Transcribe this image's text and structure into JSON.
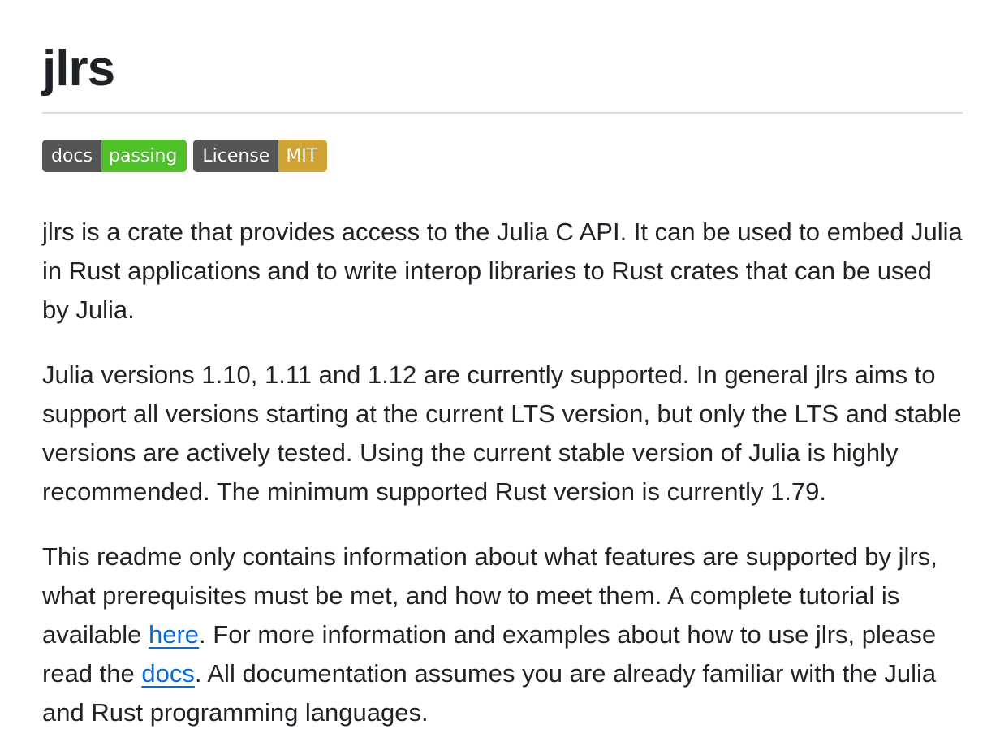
{
  "header": {
    "title": "jlrs"
  },
  "badges": [
    {
      "left": "docs",
      "right": "passing",
      "right_color": "#4fc22a"
    },
    {
      "left": "License",
      "right": "MIT",
      "right_color": "#cfa434"
    }
  ],
  "paragraphs": {
    "p1": "jlrs is a crate that provides access to the Julia C API. It can be used to embed Julia in Rust applications and to write interop libraries to Rust crates that can be used by Julia.",
    "p2": "Julia versions 1.10, 1.11 and 1.12 are currently supported. In general jlrs aims to support all versions starting at the current LTS version, but only the LTS and stable versions are actively tested. Using the current stable version of Julia is highly recommended. The minimum supported Rust version is currently 1.79.",
    "p3": {
      "part1": "This readme only contains information about what features are supported by jlrs, what prerequisites must be met, and how to meet them. A complete tutorial is available ",
      "link1": "here",
      "part2": ". For more information and examples about how to use jlrs, please read the ",
      "link2": "docs",
      "part3": ". All documentation assumes you are already familiar with the Julia and Rust programming languages."
    }
  },
  "colors": {
    "text": "#1f2328",
    "link": "#0969da",
    "rule": "#d8dee4",
    "badge_left": "#555555"
  }
}
